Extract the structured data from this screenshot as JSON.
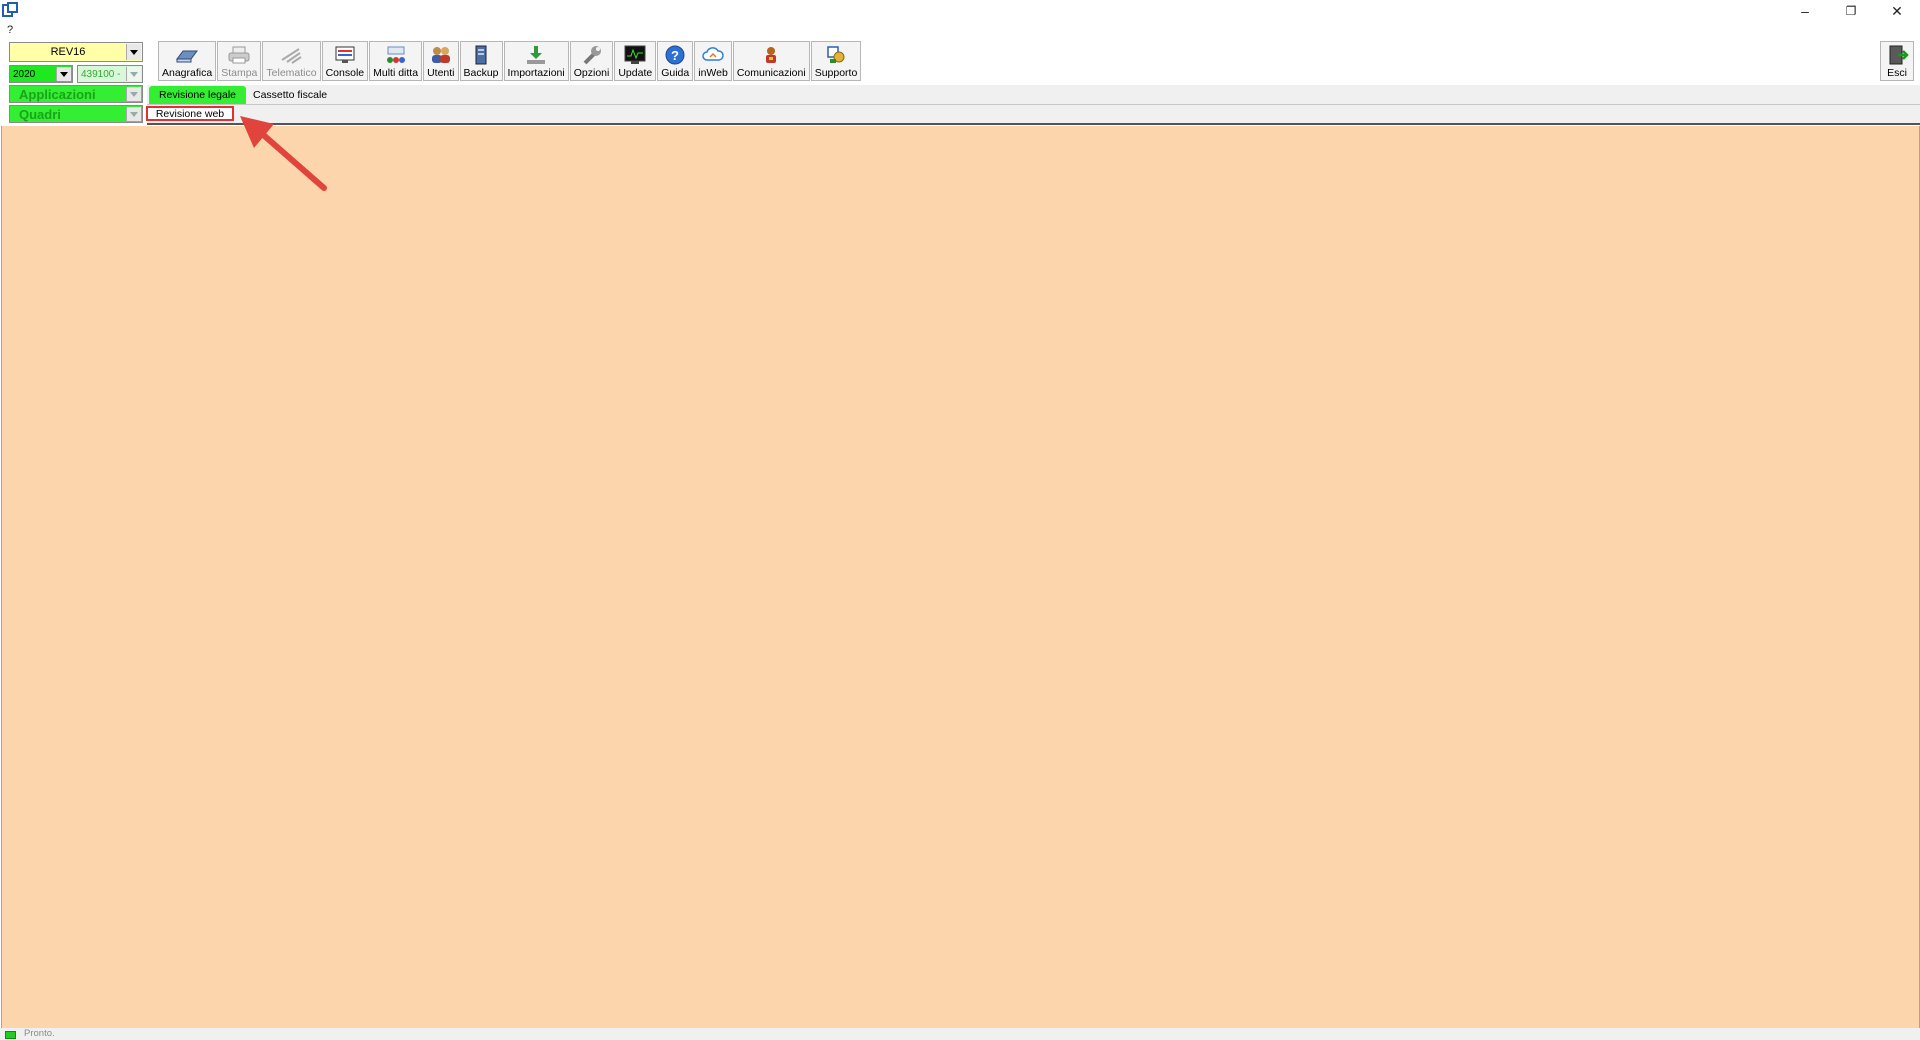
{
  "window": {
    "menu_help": "?",
    "minimize_glyph": "–",
    "restore_glyph": "❐",
    "close_glyph": "✕"
  },
  "selectors": {
    "rev": "REV16",
    "year": "2020",
    "code": "439100 -",
    "applicazioni": "Applicazioni",
    "quadri": "Quadri"
  },
  "toolbar": [
    {
      "label": "Anagrafica",
      "icon": "ledger-icon",
      "enabled": true
    },
    {
      "label": "Stampa",
      "icon": "printer-icon",
      "enabled": false
    },
    {
      "label": "Telematico",
      "icon": "telematic-icon",
      "enabled": false
    },
    {
      "label": "Console",
      "icon": "console-icon",
      "enabled": true
    },
    {
      "label": "Multi ditta",
      "icon": "multi-company-icon",
      "enabled": true
    },
    {
      "label": "Utenti",
      "icon": "users-icon",
      "enabled": true
    },
    {
      "label": "Backup",
      "icon": "backup-icon",
      "enabled": true
    },
    {
      "label": "Importazioni",
      "icon": "import-icon",
      "enabled": true
    },
    {
      "label": "Opzioni",
      "icon": "wrench-icon",
      "enabled": true
    },
    {
      "label": "Update",
      "icon": "monitor-icon",
      "enabled": true
    },
    {
      "label": "Guida",
      "icon": "help-icon",
      "enabled": true
    },
    {
      "label": "inWeb",
      "icon": "cloud-icon",
      "enabled": true
    },
    {
      "label": "Comunicazioni",
      "icon": "communications-icon",
      "enabled": true
    },
    {
      "label": "Supporto",
      "icon": "support-icon",
      "enabled": true
    }
  ],
  "exit": {
    "label": "Esci",
    "icon": "exit-door-icon"
  },
  "tabs": {
    "row1": [
      "Revisione legale",
      "Cassetto fiscale"
    ],
    "row2": [
      "Revisione web"
    ]
  },
  "status": {
    "text": "Pronto."
  },
  "colors": {
    "workspace": "#fdd5ac",
    "active_tab": "#33ee33",
    "highlight": "#e03030"
  }
}
